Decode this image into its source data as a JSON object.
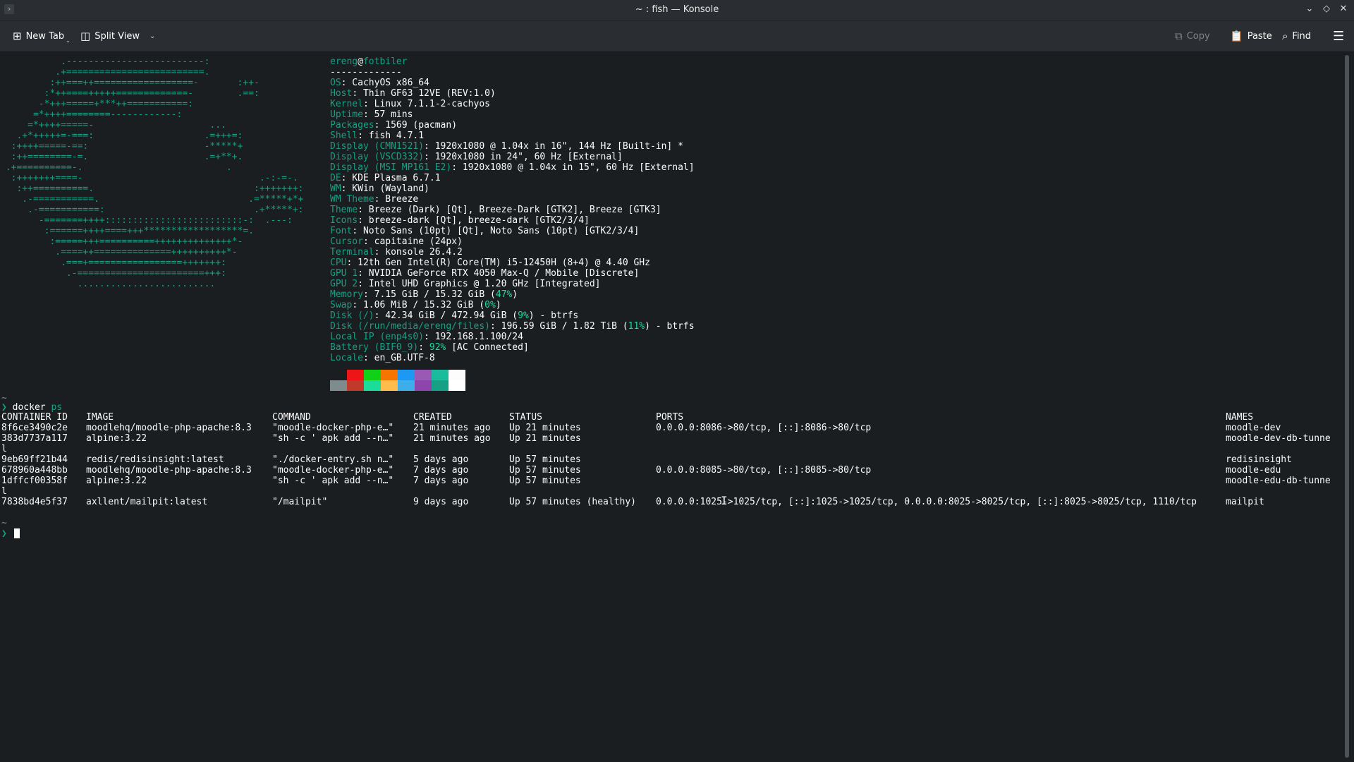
{
  "window": {
    "title": "~ : fish — Konsole",
    "controls": [
      "⌄",
      "◇",
      "✕"
    ]
  },
  "toolbar": {
    "new_tab": "New Tab",
    "split_view": "Split View",
    "copy": "Copy",
    "paste": "Paste",
    "find": "Find"
  },
  "fastfetch": {
    "user": "ereng",
    "at": "@",
    "host": "fotbiler",
    "separator": "-------------",
    "info": [
      {
        "key": "OS",
        "value": ": CachyOS x86_64"
      },
      {
        "key": "Host",
        "value": ": Thin GF63 12VE (REV:1.0)"
      },
      {
        "key": "Kernel",
        "value": ": Linux 7.1.1-2-cachyos"
      },
      {
        "key": "Uptime",
        "value": ": 57 mins"
      },
      {
        "key": "Packages",
        "value": ": 1569 (pacman)"
      },
      {
        "key": "Shell",
        "value": ": fish 4.7.1"
      },
      {
        "key": "Display (CMN1521)",
        "value": ": 1920x1080 @ 1.04x in 16\", 144 Hz [Built-in] *"
      },
      {
        "key": "Display (VSCD332)",
        "value": ": 1920x1080 in 24\", 60 Hz [External]"
      },
      {
        "key": "Display (MSI MP161 E2)",
        "value": ": 1920x1080 @ 1.04x in 15\", 60 Hz [External]"
      },
      {
        "key": "DE",
        "value": ": KDE Plasma 6.7.1"
      },
      {
        "key": "WM",
        "value": ": KWin (Wayland)"
      },
      {
        "key": "WM Theme",
        "value": ": Breeze"
      },
      {
        "key": "Theme",
        "value": ": Breeze (Dark) [Qt], Breeze-Dark [GTK2], Breeze [GTK3]"
      },
      {
        "key": "Icons",
        "value": ": breeze-dark [Qt], breeze-dark [GTK2/3/4]"
      },
      {
        "key": "Font",
        "value": ": Noto Sans (10pt) [Qt], Noto Sans (10pt) [GTK2/3/4]"
      },
      {
        "key": "Cursor",
        "value": ": capitaine (24px)"
      },
      {
        "key": "Terminal",
        "value": ": konsole 26.4.2"
      },
      {
        "key": "CPU",
        "value": ": 12th Gen Intel(R) Core(TM) i5-12450H (8+4) @ 4.40 GHz"
      },
      {
        "key": "GPU 1",
        "value": ": NVIDIA GeForce RTX 4050 Max-Q / Mobile [Discrete]"
      },
      {
        "key": "GPU 2",
        "value": ": Intel UHD Graphics @ 1.20 GHz [Integrated]"
      },
      {
        "key": "Memory",
        "value": ": 7.15 GiB / 15.32 GiB (",
        "pct": "47%",
        "tail": ")"
      },
      {
        "key": "Swap",
        "value": ": 1.06 MiB / 15.32 GiB (",
        "pct": "0%",
        "tail": ")"
      },
      {
        "key": "Disk (/)",
        "value": ": 42.34 GiB / 472.94 GiB (",
        "pct": "9%",
        "tail": ") - btrfs"
      },
      {
        "key": "Disk (/run/media/ereng/files)",
        "value": ": 196.59 GiB / 1.82 TiB (",
        "pct": "11%",
        "tail": ") - btrfs"
      },
      {
        "key": "Local IP (enp4s0)",
        "value": ": 192.168.1.100/24"
      },
      {
        "key": "Battery (BIF0_9)",
        "value": ": ",
        "pct": "92%",
        "tail": " [AC Connected]"
      },
      {
        "key": "Locale",
        "value": ": en_GB.UTF-8"
      }
    ],
    "palette_top": [
      "#1b1e20",
      "#ed1515",
      "#11d116",
      "#f67400",
      "#1d99f3",
      "#9b59b6",
      "#1abc9c",
      "#fcfcfc"
    ],
    "palette_bottom": [
      "#7f8c8d",
      "#c0392b",
      "#1cdc9a",
      "#fdbc4b",
      "#3daee9",
      "#8e44ad",
      "#16a085",
      "#ffffff"
    ]
  },
  "logo_lines": [
    "           .-------------------------:",
    "          .+=========================.",
    "         :++===++==================-       :++-",
    "        :*++====+++++=============-        .==:",
    "       -*+++=====+***++===========:",
    "      =*++++========------------:",
    "     =*++++=====-                     ...",
    "   .+*+++++=-===:                    .=+++=:",
    "  :++++=====-==:                     -*****+",
    "  :++========-=.                     .=+**+.",
    " .+==========-.                          .",
    "  :+++++++====-                                .-:-=-.",
    "   :++==========.                             :+++++++:",
    "    .-===========.                           .=*****+*+",
    "     .-===========:                           .+*****+:",
    "       -=======++++:::::::::::::::::::::::::-:  .---:",
    "        :======++++====+++******************=.",
    "         :=====+++==========++++++++++++++*-",
    "          .====++==============++++++++++*-",
    "           .===+=================+++++++:",
    "            .-=======================+++:",
    "              ........................."
  ],
  "shell": {
    "tilde": "~",
    "prompt": "❯",
    "command": "docker",
    "arg": "ps"
  },
  "docker": {
    "headers": [
      "CONTAINER ID",
      "IMAGE",
      "COMMAND",
      "CREATED",
      "STATUS",
      "PORTS",
      "NAMES"
    ],
    "rows": [
      [
        "8f6ce3490c2e",
        "moodlehq/moodle-php-apache:8.3",
        "\"moodle-docker-php-e…\"",
        "21 minutes ago",
        "Up 21 minutes",
        "0.0.0.0:8086->80/tcp, [::]:8086->80/tcp",
        "moodle-dev"
      ],
      [
        "383d7737a117",
        "alpine:3.22",
        "\"sh -c ' apk add --n…\"",
        "21 minutes ago",
        "Up 21 minutes",
        "",
        "moodle-dev-db-tunne"
      ],
      [
        "l",
        "",
        "",
        "",
        "",
        "",
        ""
      ],
      [
        "9eb69ff21b44",
        "redis/redisinsight:latest",
        "\"./docker-entry.sh n…\"",
        "5 days ago",
        "Up 57 minutes",
        "",
        "redisinsight"
      ],
      [
        "678960a448bb",
        "moodlehq/moodle-php-apache:8.3",
        "\"moodle-docker-php-e…\"",
        "7 days ago",
        "Up 57 minutes",
        "0.0.0.0:8085->80/tcp, [::]:8085->80/tcp",
        "moodle-edu"
      ],
      [
        "1dffcf00358f",
        "alpine:3.22",
        "\"sh -c ' apk add --n…\"",
        "7 days ago",
        "Up 57 minutes",
        "",
        "moodle-edu-db-tunne"
      ],
      [
        "l",
        "",
        "",
        "",
        "",
        "",
        ""
      ],
      [
        "7838bd4e5f37",
        "axllent/mailpit:latest",
        "\"/mailpit\"",
        "9 days ago",
        "Up 57 minutes (healthy)",
        "0.0.0.0:1025->1025/tcp, [::]:1025->1025/tcp, 0.0.0.0:8025->8025/tcp, [::]:8025->8025/tcp, 1110/tcp",
        "mailpit"
      ]
    ]
  }
}
